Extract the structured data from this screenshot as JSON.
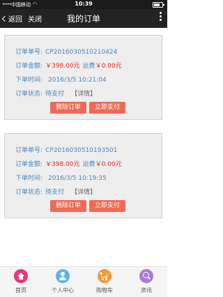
{
  "status_bar": {
    "signal": "•••••",
    "carrier": "中国移动",
    "wifi": "◠",
    "time": "10:39"
  },
  "nav": {
    "back_label": "返回",
    "close_label": "关闭",
    "title": "我的订单"
  },
  "orders": [
    {
      "number_label": "订单单号:",
      "number": "CP2016030510210424",
      "amount_label": "订单金额:",
      "amount": "￥398.00元",
      "shipping_label": "运费",
      "shipping": "￥0.00元",
      "time_label": "下单时间:",
      "time": "2016/3/5 10:21:04",
      "status_label": "订单状态:",
      "status": "待支付",
      "detail": "【详情】",
      "delete_label": "删除订单",
      "pay_label": "立即支付"
    },
    {
      "number_label": "订单单号:",
      "number": "CP2016030510193501",
      "amount_label": "订单金额:",
      "amount": "￥398.00元",
      "shipping_label": "运费",
      "shipping": "￥0.00元",
      "time_label": "下单时间:",
      "time": "2016/3/5 10:19:35",
      "status_label": "订单状态:",
      "status": "待支付",
      "detail": "【详情】",
      "delete_label": "删除订单",
      "pay_label": "立即支付"
    }
  ],
  "tabbar": {
    "items": [
      {
        "label": "首页",
        "icon": "home-icon",
        "color": "#e9357e"
      },
      {
        "label": "个人中心",
        "icon": "user-icon",
        "color": "#5fb3e8"
      },
      {
        "label": "购物车",
        "icon": "cart-icon",
        "color": "#f29a3a"
      },
      {
        "label": "资讯",
        "icon": "search-icon",
        "color": "#a97ad9"
      }
    ]
  },
  "colors": {
    "accent_red": "#e8291c",
    "label_blue": "#4a86b8",
    "button": "#ef6a55"
  }
}
